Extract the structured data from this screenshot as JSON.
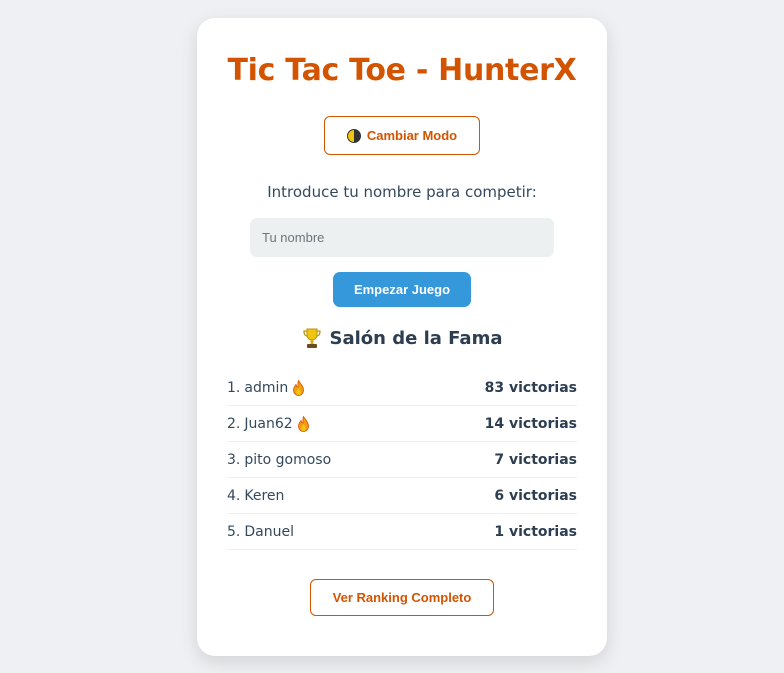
{
  "app": {
    "title": "Tic Tac Toe - HunterX"
  },
  "mode_button": {
    "icon": "half-moon-icon",
    "label": "Cambiar Modo"
  },
  "prompt": "Introduce tu nombre para competir:",
  "name_input": {
    "value": "",
    "placeholder": "Tu nombre"
  },
  "start_button": {
    "label": "Empezar Juego"
  },
  "hall_of_fame": {
    "icon": "trophy-icon",
    "title": "Salón de la Fama",
    "entries": [
      {
        "rank": "1.",
        "name": "admin",
        "hot": true,
        "wins": "83 victorias"
      },
      {
        "rank": "2.",
        "name": "Juan62",
        "hot": true,
        "wins": "14 victorias"
      },
      {
        "rank": "3.",
        "name": "pito gomoso",
        "hot": false,
        "wins": "7 victorias"
      },
      {
        "rank": "4.",
        "name": "Keren",
        "hot": false,
        "wins": "6 victorias"
      },
      {
        "rank": "5.",
        "name": "Danuel",
        "hot": false,
        "wins": "1 victorias"
      }
    ]
  },
  "ranking_button": {
    "label": "Ver Ranking Completo"
  },
  "colors": {
    "accent": "#d35400",
    "primary": "#3498db",
    "text": "#34495e",
    "background": "#eef0f3"
  }
}
